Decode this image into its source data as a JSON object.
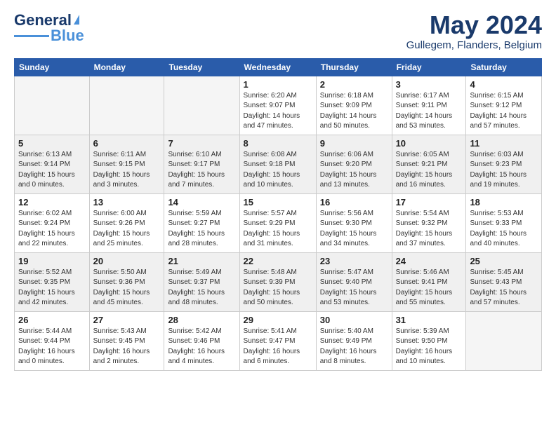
{
  "logo": {
    "text1": "General",
    "text2": "Blue"
  },
  "title": "May 2024",
  "subtitle": "Gullegem, Flanders, Belgium",
  "days_header": [
    "Sunday",
    "Monday",
    "Tuesday",
    "Wednesday",
    "Thursday",
    "Friday",
    "Saturday"
  ],
  "weeks": [
    {
      "shaded": false,
      "days": [
        {
          "number": "",
          "info": "",
          "empty": true
        },
        {
          "number": "",
          "info": "",
          "empty": true
        },
        {
          "number": "",
          "info": "",
          "empty": true
        },
        {
          "number": "1",
          "info": "Sunrise: 6:20 AM\nSunset: 9:07 PM\nDaylight: 14 hours\nand 47 minutes.",
          "empty": false
        },
        {
          "number": "2",
          "info": "Sunrise: 6:18 AM\nSunset: 9:09 PM\nDaylight: 14 hours\nand 50 minutes.",
          "empty": false
        },
        {
          "number": "3",
          "info": "Sunrise: 6:17 AM\nSunset: 9:11 PM\nDaylight: 14 hours\nand 53 minutes.",
          "empty": false
        },
        {
          "number": "4",
          "info": "Sunrise: 6:15 AM\nSunset: 9:12 PM\nDaylight: 14 hours\nand 57 minutes.",
          "empty": false
        }
      ]
    },
    {
      "shaded": true,
      "days": [
        {
          "number": "5",
          "info": "Sunrise: 6:13 AM\nSunset: 9:14 PM\nDaylight: 15 hours\nand 0 minutes.",
          "empty": false
        },
        {
          "number": "6",
          "info": "Sunrise: 6:11 AM\nSunset: 9:15 PM\nDaylight: 15 hours\nand 3 minutes.",
          "empty": false
        },
        {
          "number": "7",
          "info": "Sunrise: 6:10 AM\nSunset: 9:17 PM\nDaylight: 15 hours\nand 7 minutes.",
          "empty": false
        },
        {
          "number": "8",
          "info": "Sunrise: 6:08 AM\nSunset: 9:18 PM\nDaylight: 15 hours\nand 10 minutes.",
          "empty": false
        },
        {
          "number": "9",
          "info": "Sunrise: 6:06 AM\nSunset: 9:20 PM\nDaylight: 15 hours\nand 13 minutes.",
          "empty": false
        },
        {
          "number": "10",
          "info": "Sunrise: 6:05 AM\nSunset: 9:21 PM\nDaylight: 15 hours\nand 16 minutes.",
          "empty": false
        },
        {
          "number": "11",
          "info": "Sunrise: 6:03 AM\nSunset: 9:23 PM\nDaylight: 15 hours\nand 19 minutes.",
          "empty": false
        }
      ]
    },
    {
      "shaded": false,
      "days": [
        {
          "number": "12",
          "info": "Sunrise: 6:02 AM\nSunset: 9:24 PM\nDaylight: 15 hours\nand 22 minutes.",
          "empty": false
        },
        {
          "number": "13",
          "info": "Sunrise: 6:00 AM\nSunset: 9:26 PM\nDaylight: 15 hours\nand 25 minutes.",
          "empty": false
        },
        {
          "number": "14",
          "info": "Sunrise: 5:59 AM\nSunset: 9:27 PM\nDaylight: 15 hours\nand 28 minutes.",
          "empty": false
        },
        {
          "number": "15",
          "info": "Sunrise: 5:57 AM\nSunset: 9:29 PM\nDaylight: 15 hours\nand 31 minutes.",
          "empty": false
        },
        {
          "number": "16",
          "info": "Sunrise: 5:56 AM\nSunset: 9:30 PM\nDaylight: 15 hours\nand 34 minutes.",
          "empty": false
        },
        {
          "number": "17",
          "info": "Sunrise: 5:54 AM\nSunset: 9:32 PM\nDaylight: 15 hours\nand 37 minutes.",
          "empty": false
        },
        {
          "number": "18",
          "info": "Sunrise: 5:53 AM\nSunset: 9:33 PM\nDaylight: 15 hours\nand 40 minutes.",
          "empty": false
        }
      ]
    },
    {
      "shaded": true,
      "days": [
        {
          "number": "19",
          "info": "Sunrise: 5:52 AM\nSunset: 9:35 PM\nDaylight: 15 hours\nand 42 minutes.",
          "empty": false
        },
        {
          "number": "20",
          "info": "Sunrise: 5:50 AM\nSunset: 9:36 PM\nDaylight: 15 hours\nand 45 minutes.",
          "empty": false
        },
        {
          "number": "21",
          "info": "Sunrise: 5:49 AM\nSunset: 9:37 PM\nDaylight: 15 hours\nand 48 minutes.",
          "empty": false
        },
        {
          "number": "22",
          "info": "Sunrise: 5:48 AM\nSunset: 9:39 PM\nDaylight: 15 hours\nand 50 minutes.",
          "empty": false
        },
        {
          "number": "23",
          "info": "Sunrise: 5:47 AM\nSunset: 9:40 PM\nDaylight: 15 hours\nand 53 minutes.",
          "empty": false
        },
        {
          "number": "24",
          "info": "Sunrise: 5:46 AM\nSunset: 9:41 PM\nDaylight: 15 hours\nand 55 minutes.",
          "empty": false
        },
        {
          "number": "25",
          "info": "Sunrise: 5:45 AM\nSunset: 9:43 PM\nDaylight: 15 hours\nand 57 minutes.",
          "empty": false
        }
      ]
    },
    {
      "shaded": false,
      "days": [
        {
          "number": "26",
          "info": "Sunrise: 5:44 AM\nSunset: 9:44 PM\nDaylight: 16 hours\nand 0 minutes.",
          "empty": false
        },
        {
          "number": "27",
          "info": "Sunrise: 5:43 AM\nSunset: 9:45 PM\nDaylight: 16 hours\nand 2 minutes.",
          "empty": false
        },
        {
          "number": "28",
          "info": "Sunrise: 5:42 AM\nSunset: 9:46 PM\nDaylight: 16 hours\nand 4 minutes.",
          "empty": false
        },
        {
          "number": "29",
          "info": "Sunrise: 5:41 AM\nSunset: 9:47 PM\nDaylight: 16 hours\nand 6 minutes.",
          "empty": false
        },
        {
          "number": "30",
          "info": "Sunrise: 5:40 AM\nSunset: 9:49 PM\nDaylight: 16 hours\nand 8 minutes.",
          "empty": false
        },
        {
          "number": "31",
          "info": "Sunrise: 5:39 AM\nSunset: 9:50 PM\nDaylight: 16 hours\nand 10 minutes.",
          "empty": false
        },
        {
          "number": "",
          "info": "",
          "empty": true
        }
      ]
    }
  ]
}
